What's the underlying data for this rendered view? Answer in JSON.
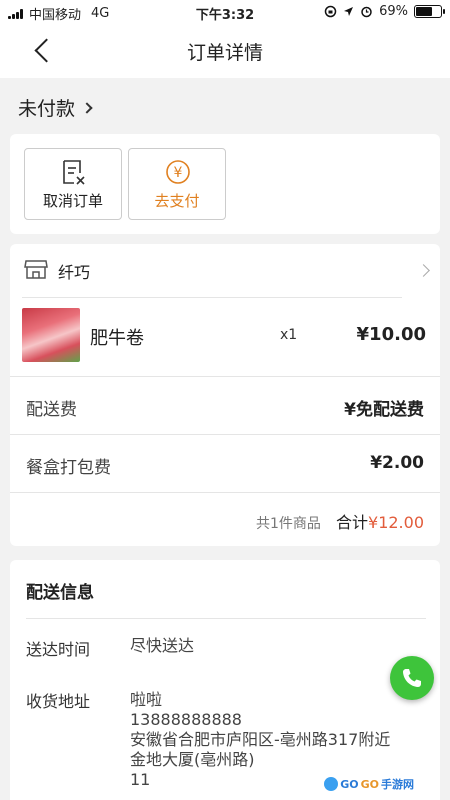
{
  "status_bar": {
    "carrier": "中国移动",
    "network": "4G",
    "time": "下午3:32",
    "battery_percent": "69%",
    "battery_level": 0.69
  },
  "nav": {
    "title": "订单详情"
  },
  "order_status": {
    "label": "未付款"
  },
  "actions": {
    "cancel_label": "取消订单",
    "pay_label": "去支付",
    "pay_symbol": "¥"
  },
  "shop": {
    "name": "纤巧"
  },
  "item": {
    "name": "肥牛卷",
    "qty": "x1",
    "price": "¥10.00"
  },
  "fees": [
    {
      "label": "配送费",
      "value": "¥免配送费"
    },
    {
      "label": "餐盒打包费",
      "value": "¥2.00"
    }
  ],
  "summary": {
    "count_text": "共1件商品",
    "total_label": "合计",
    "total_value": "¥12.00"
  },
  "delivery": {
    "title": "配送信息",
    "time_label": "送达时间",
    "time_value": "尽快送达",
    "address_label": "收货地址",
    "recipient": "啦啦",
    "phone": "13888888888",
    "address_line1": "安徽省合肥市庐阳区-亳州路317附近",
    "address_line2": "金地大厦(亳州路)",
    "address_line3": "11"
  },
  "watermark": {
    "part1": "GO",
    "part2": "GO",
    "part3": "手游网"
  },
  "colors": {
    "accent_orange": "#e08020",
    "price_red": "#e25c3b",
    "call_green": "#3ec43b"
  },
  "icons": [
    "back-icon",
    "chevron-right-icon",
    "cancel-order-icon",
    "yuan-icon",
    "store-icon",
    "phone-icon"
  ]
}
